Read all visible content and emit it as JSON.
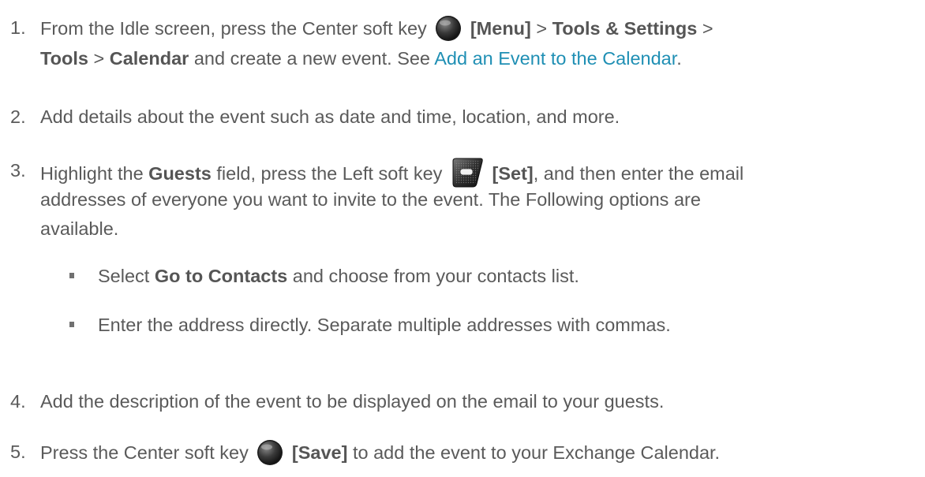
{
  "steps": [
    {
      "num": "1.",
      "parts": {
        "a": "From the Idle screen, press the Center soft key",
        "b": "[Menu]",
        "c": " > ",
        "d": "Tools & Settings",
        "e": " >",
        "f": "Tools",
        "g": " > ",
        "h": "Calendar",
        "i": " and create a new event. See ",
        "link": "Add an Event to the Calendar",
        "j": "."
      },
      "icon": "center-soft-key-icon"
    },
    {
      "num": "2.",
      "text": "Add details about the event such as date and time, location, and more."
    },
    {
      "num": "3.",
      "parts": {
        "a": "Highlight the ",
        "b": "Guests",
        "c": " field, press the Left soft key",
        "d": "[Set]",
        "e": ", and then enter the email",
        "f": "addresses of everyone you want to invite to the event. The Following options are",
        "g": "available."
      },
      "icon": "left-soft-key-icon",
      "bullets": [
        {
          "pre": "Select ",
          "bold": "Go to Contacts",
          "post": " and choose from your contacts list."
        },
        {
          "text": "Enter the address directly. Separate multiple addresses with commas."
        }
      ]
    },
    {
      "num": "4.",
      "text": "Add the description of the event to be displayed on the email to your guests."
    },
    {
      "num": "5.",
      "parts": {
        "a": "Press the Center soft key",
        "b": "[Save]",
        "c": " to add the event to your Exchange Calendar."
      },
      "icon": "center-soft-key-icon"
    }
  ],
  "colors": {
    "text": "#5a5a5a",
    "link": "#1f8fb4"
  }
}
